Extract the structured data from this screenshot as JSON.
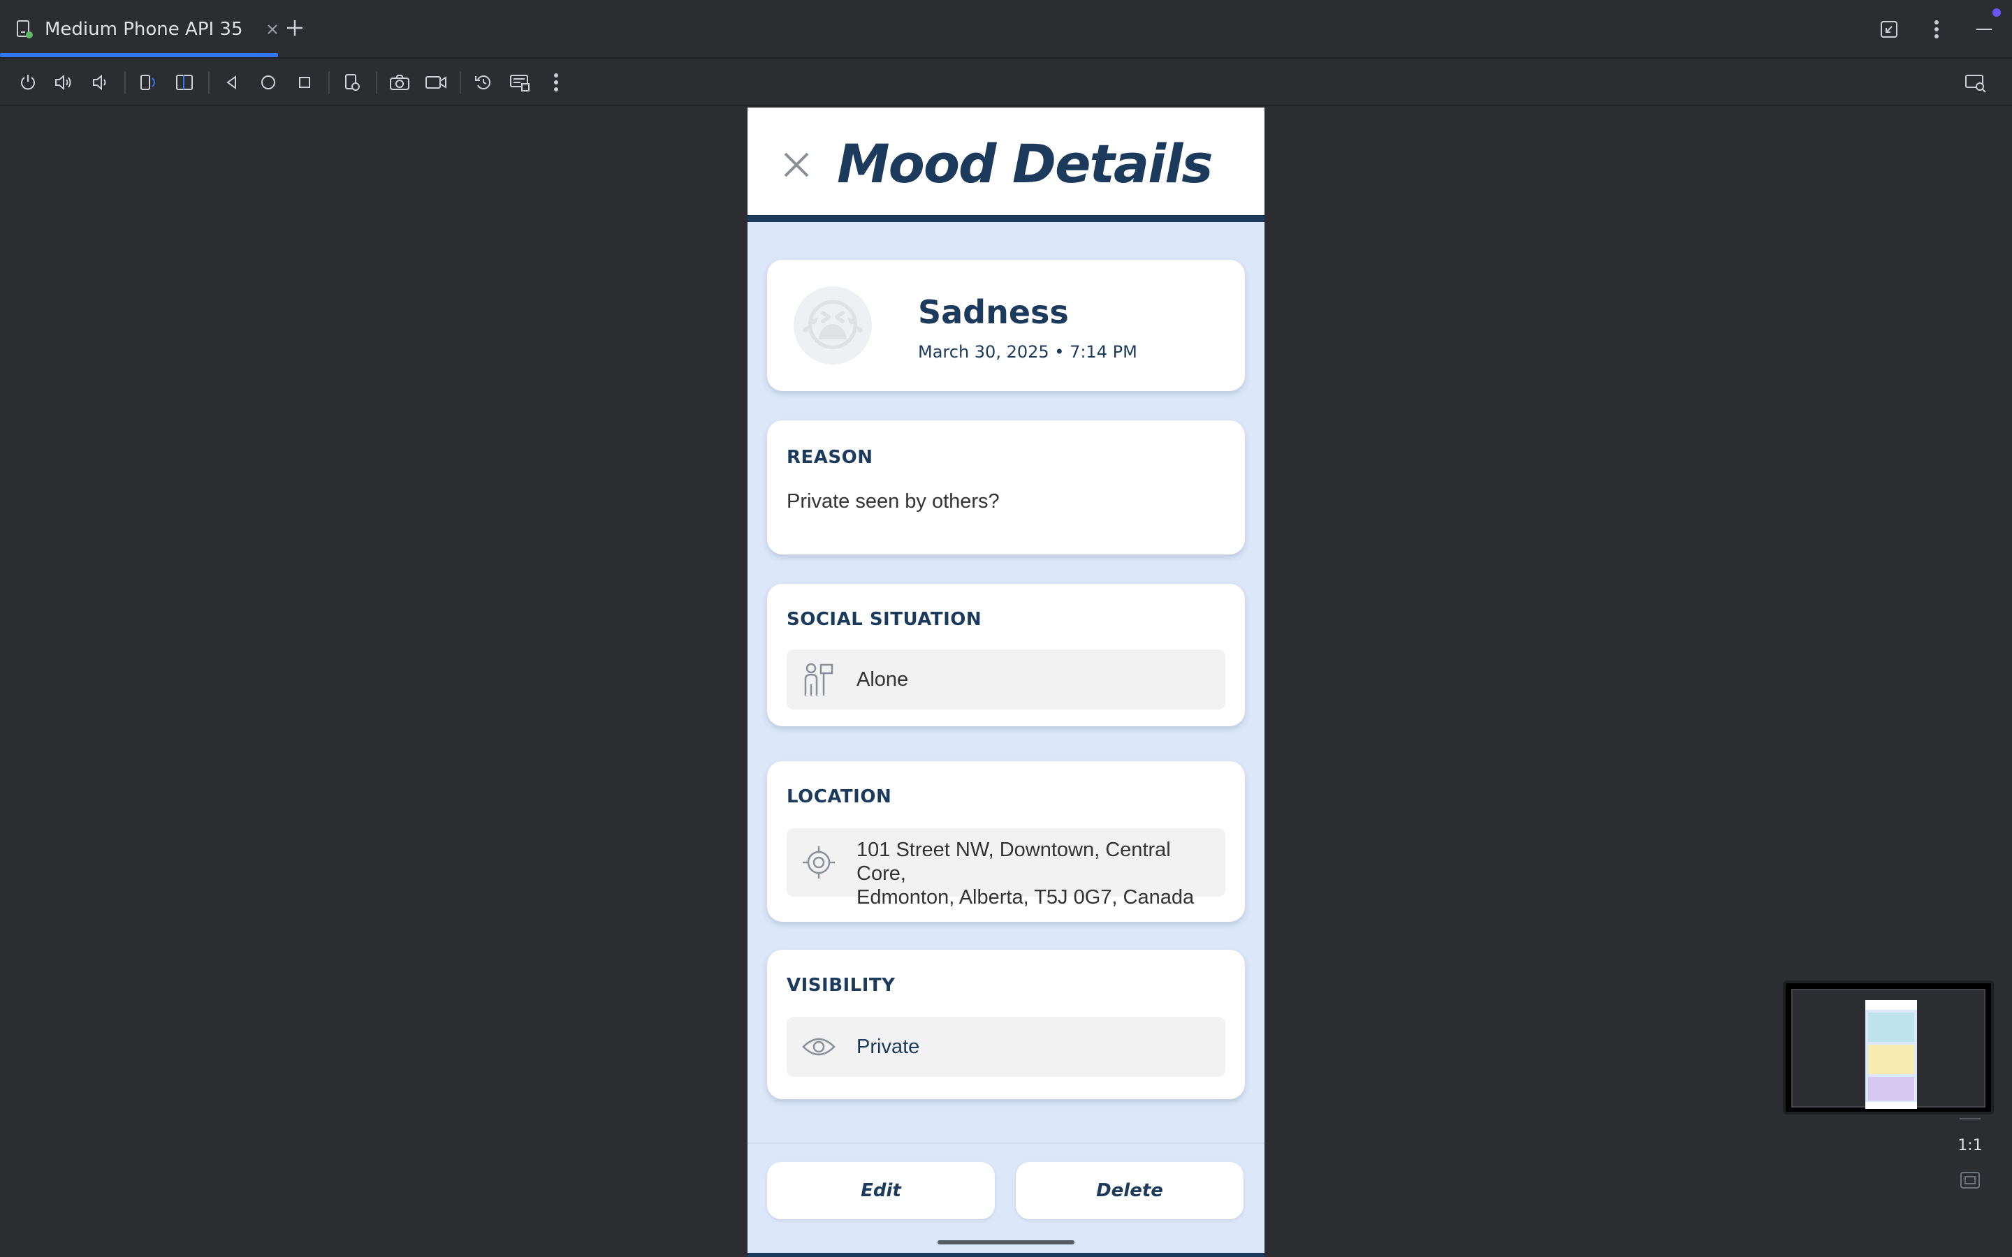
{
  "window": {
    "tab_title": "Medium Phone API 35",
    "tab_close_icon": "close-icon",
    "new_tab_icon": "plus-icon",
    "right_icons": [
      "restore-window-icon",
      "more-vert-icon",
      "minimize-icon"
    ]
  },
  "toolbar": {
    "icons": [
      "power-icon",
      "volume-up-icon",
      "volume-down-icon",
      "rotate-left-icon",
      "rotate-right-icon",
      "back-icon",
      "home-icon",
      "overview-icon",
      "device-settings-icon",
      "camera-icon",
      "video-record-icon",
      "snapshot-restore-icon",
      "extended-controls-icon",
      "more-vert-icon"
    ],
    "right_icon": "device-mirror-icon"
  },
  "app": {
    "title": "Mood Details",
    "close_icon": "close-icon",
    "mood": {
      "name": "Sadness",
      "emoji": "😭",
      "datetime": "March 30, 2025 • 7:14 PM"
    },
    "reason": {
      "label": "REASON",
      "text": "Private seen by others?"
    },
    "social": {
      "label": "SOCIAL SITUATION",
      "value": "Alone",
      "icon": "person-icon"
    },
    "location": {
      "label": "LOCATION",
      "line1": "101 Street NW, Downtown, Central Core,",
      "line2": "Edmonton, Alberta, T5J 0G7, Canada",
      "icon": "gps-target-icon"
    },
    "visibility": {
      "label": "VISIBILITY",
      "value": "Private",
      "icon": "eye-icon"
    },
    "buttons": {
      "edit": "Edit",
      "delete": "Delete"
    }
  },
  "zoom": {
    "label": "1:1"
  },
  "colors": {
    "ide_bg": "#2b2d30",
    "accent": "#3574f0",
    "app_navy": "#1b3a5c",
    "app_bg": "#dce7f9"
  }
}
